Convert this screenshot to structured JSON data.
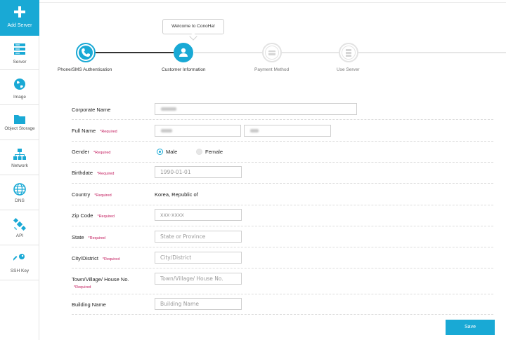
{
  "sidebar": {
    "add_server": "Add Server",
    "items": [
      {
        "label": "Server",
        "icon": "server-icon"
      },
      {
        "label": "Image",
        "icon": "globe-icon"
      },
      {
        "label": "Object Storage",
        "icon": "folder-icon"
      },
      {
        "label": "Network",
        "icon": "network-icon"
      },
      {
        "label": "DNS",
        "icon": "globe-grid-icon"
      },
      {
        "label": "API",
        "icon": "satellite-icon"
      },
      {
        "label": "SSH Key",
        "icon": "key-icon"
      }
    ]
  },
  "stepper": {
    "tooltip": "Welcome to ConoHa!",
    "steps": [
      {
        "label": "Phone/SMS Authentication",
        "state": "done"
      },
      {
        "label": "Customer Information",
        "state": "active"
      },
      {
        "label": "Payment Method",
        "state": "todo"
      },
      {
        "label": "Use Server",
        "state": "todo"
      }
    ]
  },
  "form": {
    "required_tag": "*Required",
    "corporate_name": {
      "label": "Corporate Name"
    },
    "full_name": {
      "label": "Full Name"
    },
    "gender": {
      "label": "Gender",
      "options": [
        "Male",
        "Female"
      ],
      "selected": "Male"
    },
    "birthdate": {
      "label": "Birthdate",
      "placeholder": "1990-01-01"
    },
    "country": {
      "label": "Country",
      "value": "Korea, Republic of"
    },
    "zip_code": {
      "label": "Zip Code",
      "placeholder": "xxx-xxxx"
    },
    "state": {
      "label": "State",
      "placeholder": "State or Province"
    },
    "city": {
      "label": "City/District",
      "placeholder": "City/District"
    },
    "town": {
      "label": "Town/Village/ House No.",
      "placeholder": "Town/Village/ House No."
    },
    "building": {
      "label": "Building Name",
      "placeholder": "Building Name"
    }
  },
  "actions": {
    "save": "Save"
  },
  "colors": {
    "accent": "#19a9d5",
    "required": "#c2185b"
  }
}
